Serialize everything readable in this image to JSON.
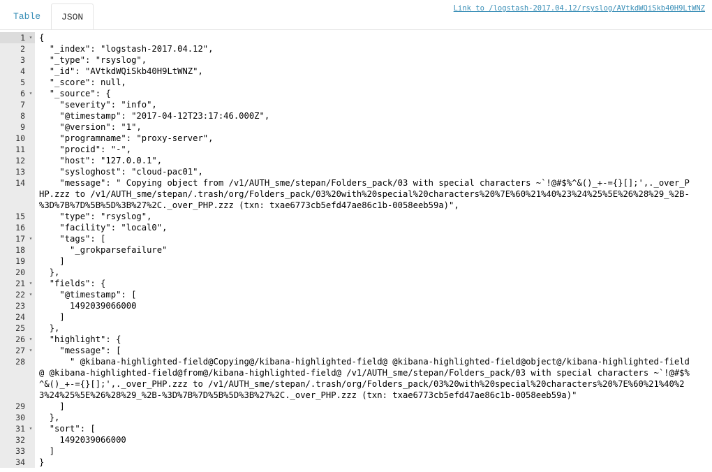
{
  "tabs": [
    {
      "label": "Table",
      "active": false
    },
    {
      "label": "JSON",
      "active": true
    }
  ],
  "doc_link": "Link to /logstash-2017.04.12/rsyslog/AVtkdWQiSkb40H9LtWNZ",
  "colors": {
    "link": "#3a8fb7",
    "gutter_bg": "#ebebeb",
    "number": "#1c00cf"
  },
  "lines": [
    {
      "n": "1",
      "fold": true,
      "text": "{"
    },
    {
      "n": "2",
      "fold": false,
      "text": "  \"_index\": \"logstash-2017.04.12\","
    },
    {
      "n": "3",
      "fold": false,
      "text": "  \"_type\": \"rsyslog\","
    },
    {
      "n": "4",
      "fold": false,
      "text": "  \"_id\": \"AVtkdWQiSkb40H9LtWNZ\","
    },
    {
      "n": "5",
      "fold": false,
      "text": "  \"_score\": null,"
    },
    {
      "n": "6",
      "fold": true,
      "text": "  \"_source\": {"
    },
    {
      "n": "7",
      "fold": false,
      "text": "    \"severity\": \"info\","
    },
    {
      "n": "8",
      "fold": false,
      "text": "    \"@timestamp\": \"2017-04-12T23:17:46.000Z\","
    },
    {
      "n": "9",
      "fold": false,
      "text": "    \"@version\": \"1\","
    },
    {
      "n": "10",
      "fold": false,
      "text": "    \"programname\": \"proxy-server\","
    },
    {
      "n": "11",
      "fold": false,
      "text": "    \"procid\": \"-\","
    },
    {
      "n": "12",
      "fold": false,
      "text": "    \"host\": \"127.0.0.1\","
    },
    {
      "n": "13",
      "fold": false,
      "text": "    \"sysloghost\": \"cloud-pac01\","
    },
    {
      "n": "14",
      "fold": false,
      "text": "    \"message\": \" Copying object from /v1/AUTH_sme/stepan/Folders_pack/03 with special characters ~`!@#$%^&()_+-={}[];',._over_PHP.zzz to /v1/AUTH_sme/stepan/.trash/org/Folders_pack/03%20with%20special%20characters%20%7E%60%21%40%23%24%25%5E%26%28%29_%2B-%3D%7B%7D%5B%5D%3B%27%2C._over_PHP.zzz (txn: txae6773cb5efd47ae86c1b-0058eeb59a)\","
    },
    {
      "n": "15",
      "fold": false,
      "text": "    \"type\": \"rsyslog\","
    },
    {
      "n": "16",
      "fold": false,
      "text": "    \"facility\": \"local0\","
    },
    {
      "n": "17",
      "fold": true,
      "text": "    \"tags\": ["
    },
    {
      "n": "18",
      "fold": false,
      "text": "      \"_grokparsefailure\""
    },
    {
      "n": "19",
      "fold": false,
      "text": "    ]"
    },
    {
      "n": "20",
      "fold": false,
      "text": "  },"
    },
    {
      "n": "21",
      "fold": true,
      "text": "  \"fields\": {"
    },
    {
      "n": "22",
      "fold": true,
      "text": "    \"@timestamp\": ["
    },
    {
      "n": "23",
      "fold": false,
      "text": "      1492039066000"
    },
    {
      "n": "24",
      "fold": false,
      "text": "    ]"
    },
    {
      "n": "25",
      "fold": false,
      "text": "  },"
    },
    {
      "n": "26",
      "fold": true,
      "text": "  \"highlight\": {"
    },
    {
      "n": "27",
      "fold": true,
      "text": "    \"message\": ["
    },
    {
      "n": "28",
      "fold": false,
      "text": "      \" @kibana-highlighted-field@Copying@/kibana-highlighted-field@ @kibana-highlighted-field@object@/kibana-highlighted-field@ @kibana-highlighted-field@from@/kibana-highlighted-field@ /v1/AUTH_sme/stepan/Folders_pack/03 with special characters ~`!@#$%^&()_+-={}[];',._over_PHP.zzz to /v1/AUTH_sme/stepan/.trash/org/Folders_pack/03%20with%20special%20characters%20%7E%60%21%40%23%24%25%5E%26%28%29_%2B-%3D%7B%7D%5B%5D%3B%27%2C._over_PHP.zzz (txn: txae6773cb5efd47ae86c1b-0058eeb59a)\""
    },
    {
      "n": "29",
      "fold": false,
      "text": "    ]"
    },
    {
      "n": "30",
      "fold": false,
      "text": "  },"
    },
    {
      "n": "31",
      "fold": true,
      "text": "  \"sort\": ["
    },
    {
      "n": "32",
      "fold": false,
      "text": "    1492039066000"
    },
    {
      "n": "33",
      "fold": false,
      "text": "  ]"
    },
    {
      "n": "34",
      "fold": false,
      "text": "}"
    }
  ]
}
